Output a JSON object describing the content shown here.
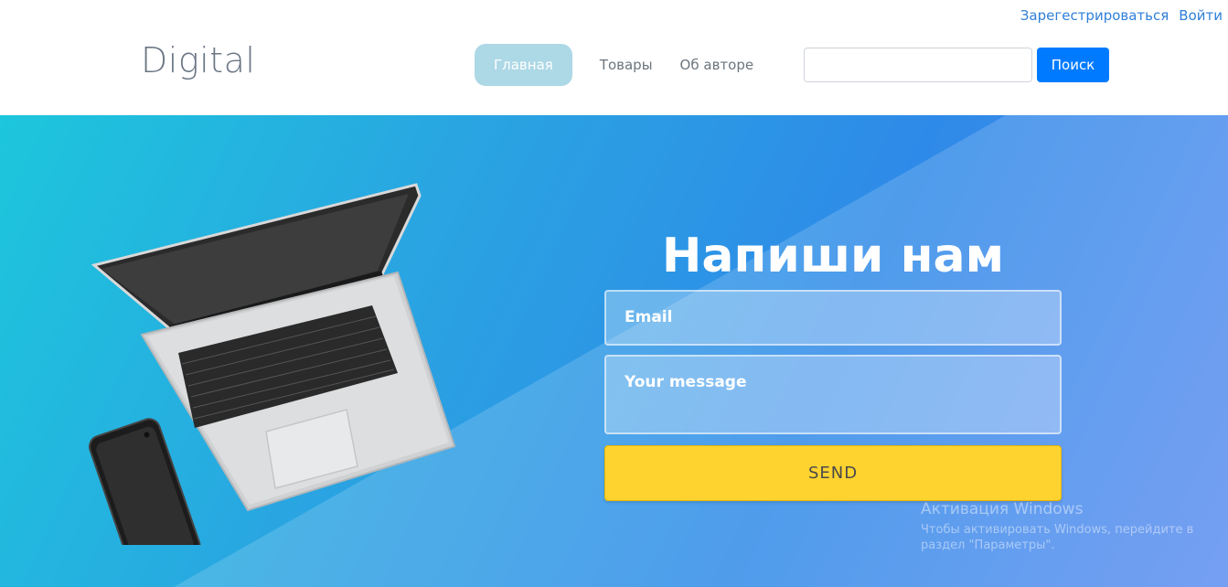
{
  "top_links": {
    "register": "Зарегестрироваться",
    "login": "Войти"
  },
  "header": {
    "logo": "Digital",
    "nav": [
      {
        "label": "Главная",
        "active": true
      },
      {
        "label": "Товары",
        "active": false
      },
      {
        "label": "Об авторе",
        "active": false
      }
    ],
    "search": {
      "value": "",
      "button": "Поиск"
    }
  },
  "hero": {
    "title": "Напиши нам",
    "email_placeholder": "Email",
    "message_placeholder": "Your message",
    "send_label": "SEND"
  },
  "watermark": {
    "title": "Активация Windows",
    "subtitle": "Чтобы активировать Windows, перейдите в раздел \"Параметры\"."
  },
  "colors": {
    "accent": "#007bff",
    "nav_active": "#add8e6",
    "send": "#fed330",
    "hero_start": "#1dc6dc",
    "hero_end": "#5c8df0"
  }
}
